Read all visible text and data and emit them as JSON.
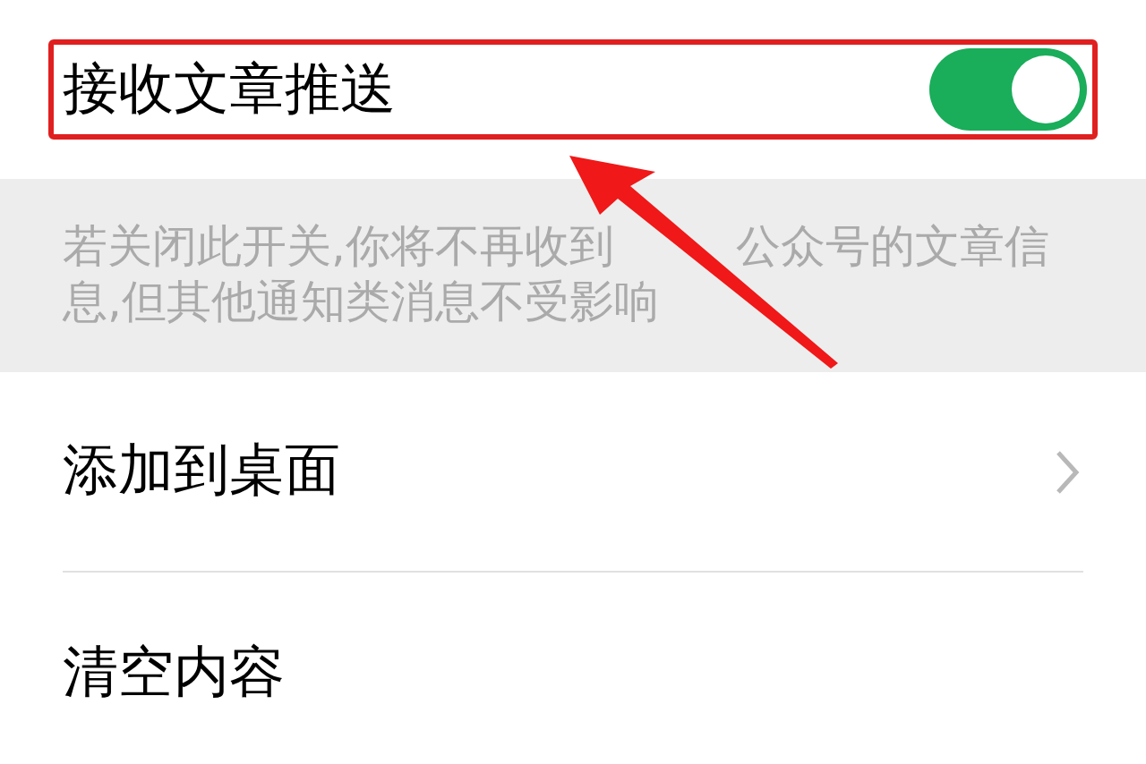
{
  "push_setting": {
    "label": "接收文章推送",
    "on": true,
    "highlighted": true
  },
  "hint": [
    [
      "若关闭此开关,你将不再收到",
      "公众号的文章信"
    ],
    [
      "息,但其他通知类消息不受影响"
    ]
  ],
  "menu_items": [
    {
      "label": "添加到桌面",
      "kind": "link"
    },
    {
      "label": "清空内容",
      "kind": "action"
    }
  ]
}
